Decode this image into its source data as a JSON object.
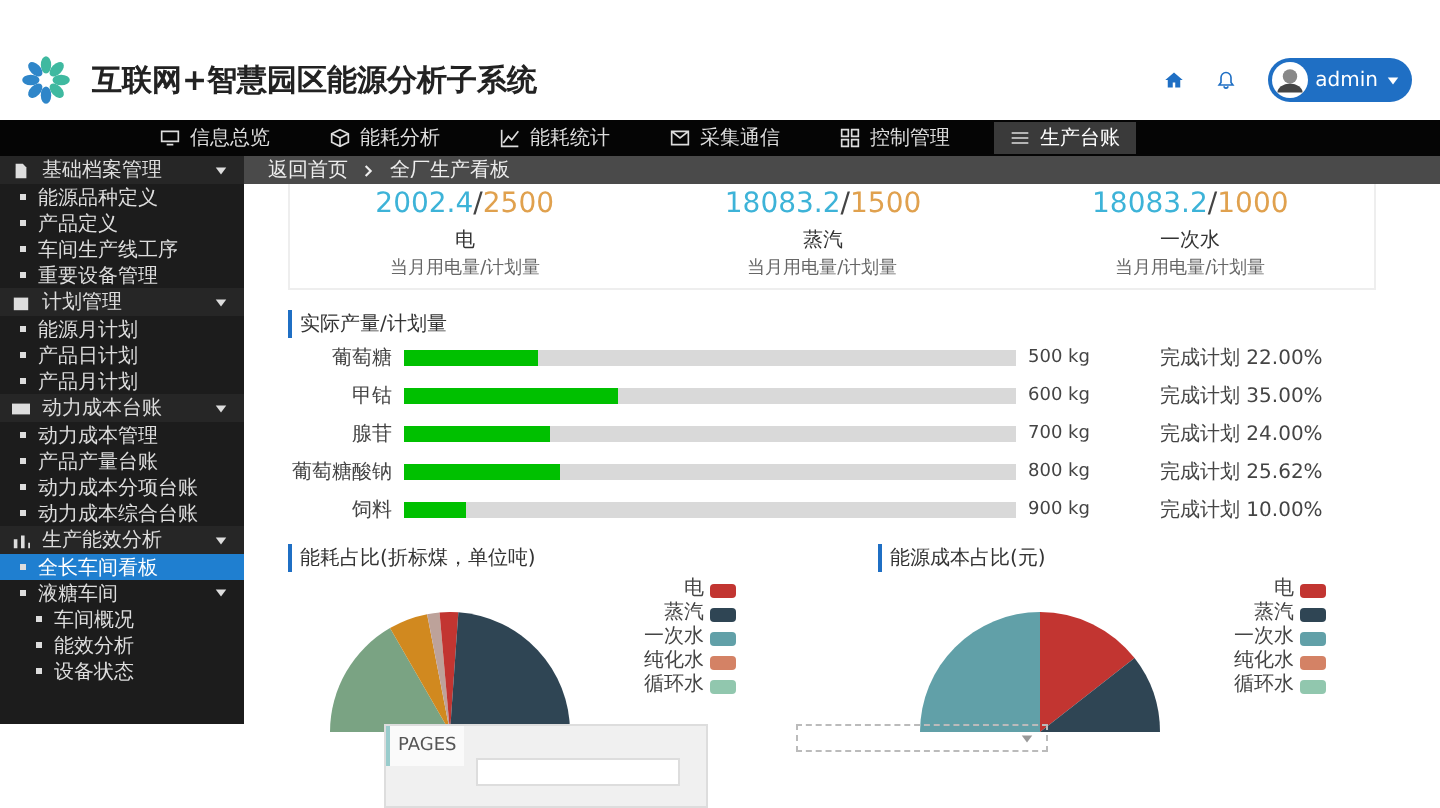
{
  "header": {
    "title": "互联网+智慧园区能源分析子系统",
    "user": "admin"
  },
  "nav": [
    {
      "label": "信息总览",
      "selected": false
    },
    {
      "label": "能耗分析",
      "selected": false
    },
    {
      "label": "能耗统计",
      "selected": false
    },
    {
      "label": "采集通信",
      "selected": false
    },
    {
      "label": "控制管理",
      "selected": false
    },
    {
      "label": "生产台账",
      "selected": true
    }
  ],
  "sidebar": {
    "items": [
      {
        "label": "基础档案管理",
        "expanded": true,
        "children": [
          {
            "label": "能源品种定义",
            "selected": false
          },
          {
            "label": "产品定义",
            "selected": false
          },
          {
            "label": "车间生产线工序",
            "selected": false
          },
          {
            "label": "重要设备管理",
            "selected": false
          }
        ]
      },
      {
        "label": "计划管理",
        "expanded": true,
        "children": [
          {
            "label": "能源月计划",
            "selected": false
          },
          {
            "label": "产品日计划",
            "selected": false
          },
          {
            "label": "产品月计划",
            "selected": false
          }
        ]
      },
      {
        "label": "动力成本台账",
        "expanded": true,
        "children": [
          {
            "label": "动力成本管理",
            "selected": false
          },
          {
            "label": "产品产量台账",
            "selected": false
          },
          {
            "label": "动力成本分项台账",
            "selected": false
          },
          {
            "label": "动力成本综合台账",
            "selected": false
          }
        ]
      },
      {
        "label": "生产能效分析",
        "expanded": true,
        "children": [
          {
            "label": "全长车间看板",
            "selected": true
          },
          {
            "label": "液糖车间",
            "selected": false,
            "expanded": true,
            "children": [
              {
                "label": "车间概况",
                "selected": false
              },
              {
                "label": "能效分析",
                "selected": false
              },
              {
                "label": "设备状态",
                "selected": false
              }
            ]
          }
        ]
      }
    ]
  },
  "breadcrumb": [
    "返回首页",
    "全厂生产看板"
  ],
  "stats": [
    {
      "actual": "2002.4",
      "divider": "/",
      "plan": "2500",
      "name": "电",
      "caption": "当月用电量/计划量"
    },
    {
      "actual": "18083.2",
      "divider": "/",
      "plan": "1500",
      "name": "蒸汽",
      "caption": "当月用电量/计划量"
    },
    {
      "actual": "18083.2",
      "divider": "/",
      "plan": "1000",
      "name": "一次水",
      "caption": "当月用电量/计划量"
    }
  ],
  "production": {
    "title": "实际产量/计划量",
    "rows": [
      {
        "name": "葡萄糖",
        "level": 0.22,
        "amount": "500 kg",
        "completion": "完成计划 22.00%"
      },
      {
        "name": "甲钴",
        "level": 0.35,
        "amount": "600 kg",
        "completion": "完成计划 35.00%"
      },
      {
        "name": "腺苷",
        "level": 0.24,
        "amount": "700 kg",
        "completion": "完成计划 24.00%"
      },
      {
        "name": "葡萄糖酸钠",
        "level": 0.2562,
        "amount": "800 kg",
        "completion": "完成计划 25.62%"
      },
      {
        "name": "饲料",
        "level": 0.1,
        "amount": "900 kg",
        "completion": "完成计划 10.00%"
      }
    ]
  },
  "pies": [
    {
      "title": "能耗占比(折标煤，单位吨)",
      "legend": [
        {
          "label": "电",
          "color": "#c23531"
        },
        {
          "label": "蒸汽",
          "color": "#2f4554"
        },
        {
          "label": "一次水",
          "color": "#61a0a8"
        },
        {
          "label": "纯化水",
          "color": "#d48265"
        },
        {
          "label": "循环水",
          "color": "#91c7ae"
        }
      ]
    },
    {
      "title": "能源成本占比(元)",
      "legend": [
        {
          "label": "电",
          "color": "#c23531"
        },
        {
          "label": "蒸汽",
          "color": "#2f4554"
        },
        {
          "label": "一次水",
          "color": "#61a0a8"
        },
        {
          "label": "纯化水",
          "color": "#d48265"
        },
        {
          "label": "循环水",
          "color": "#91c7ae"
        }
      ]
    }
  ],
  "pages_panel": {
    "tab": "PAGES"
  }
}
